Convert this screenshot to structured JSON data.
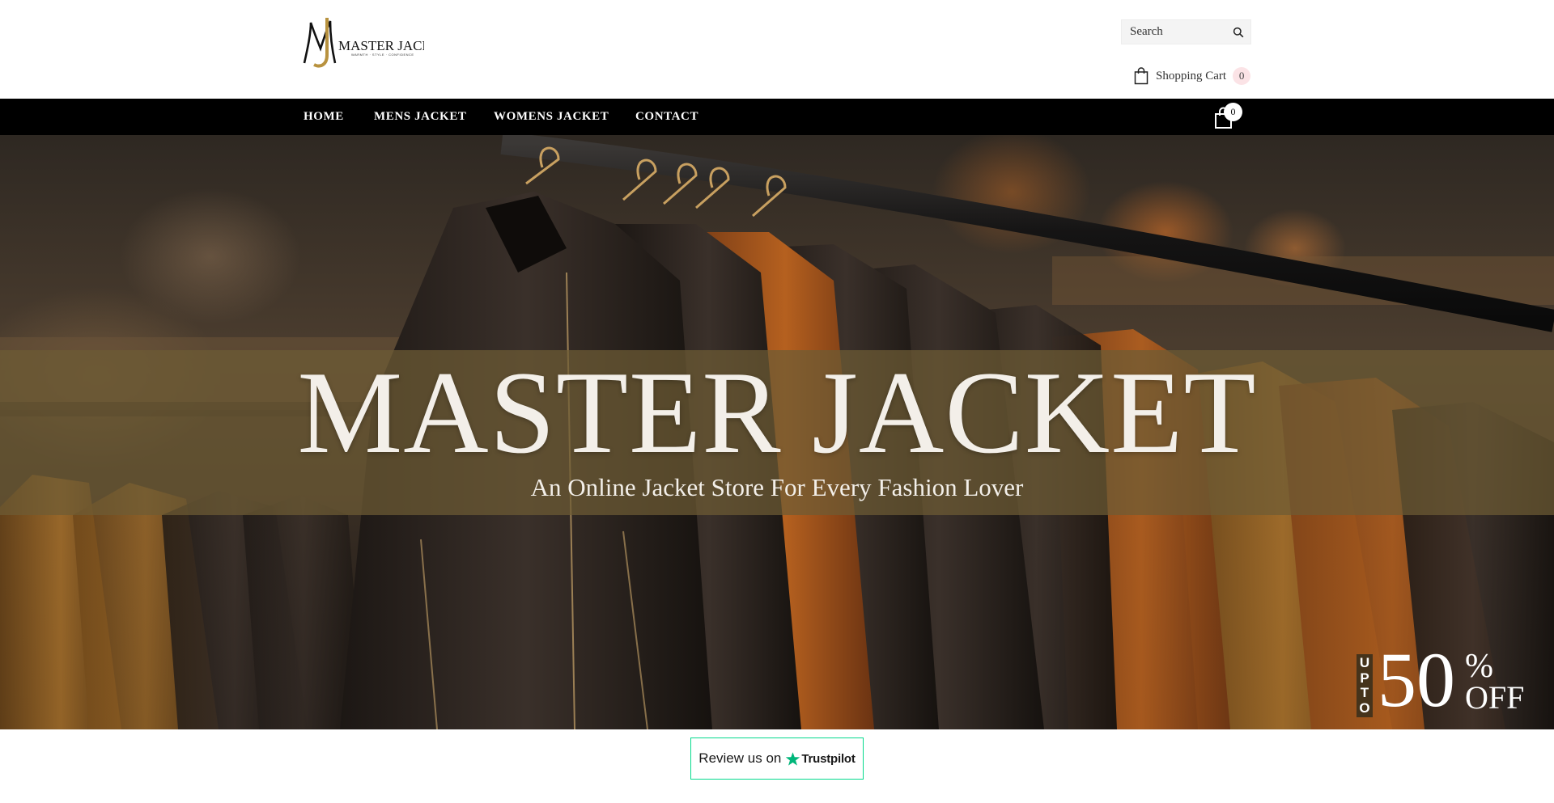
{
  "header": {
    "logo": {
      "initials": "MJ",
      "wordmark": "MASTER JACKET",
      "tagline": "WARMTH · STYLE · CONFIDENCE"
    },
    "search": {
      "placeholder": "Search",
      "icon": "search-icon"
    },
    "cart": {
      "label": "Shopping Cart",
      "count": "0",
      "icon": "shopping-bag-icon"
    }
  },
  "nav": {
    "items": [
      {
        "label": "HOME"
      },
      {
        "label": "MENS JACKET"
      },
      {
        "label": "WOMENS JACKET"
      },
      {
        "label": "CONTACT"
      }
    ],
    "cart_count": "0",
    "cart_icon": "shopping-bag-icon"
  },
  "hero": {
    "title": "MASTER JACKET",
    "subtitle": "An Online Jacket Store For Every Fashion Lover",
    "promo": {
      "upto": [
        "U",
        "P",
        "T",
        "O"
      ],
      "amount": "50",
      "percent": "%",
      "off": "OFF"
    }
  },
  "trustpilot": {
    "text": "Review us on",
    "brand": "Trustpilot",
    "star_color": "#00b67a",
    "border_color": "#04da8d"
  },
  "colors": {
    "nav_bg": "#000000",
    "badge_bg": "#fbe3e6",
    "hero_band": "#6e5c34"
  }
}
